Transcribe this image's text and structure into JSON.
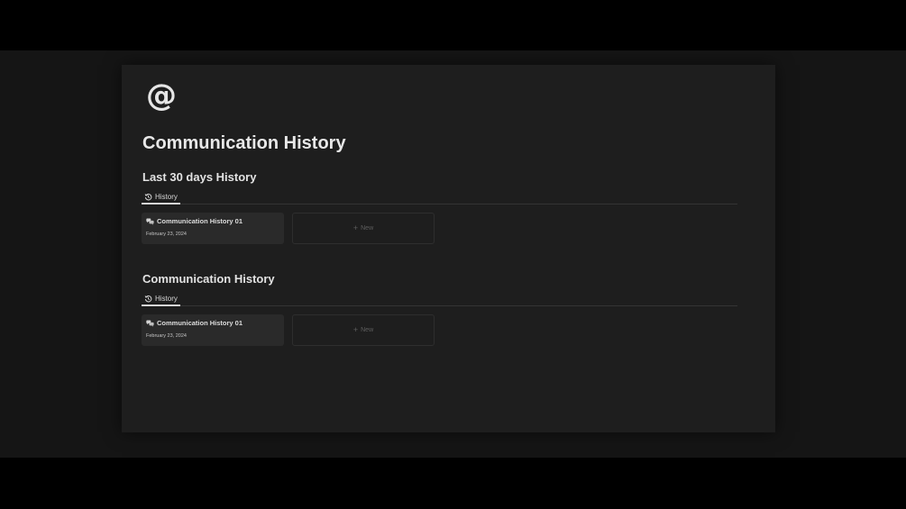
{
  "page": {
    "icon": "at-sign-icon",
    "title": "Communication History"
  },
  "sections": [
    {
      "title": "Last 30 days History",
      "tab": {
        "label": "History",
        "icon": "history-icon"
      },
      "cards": [
        {
          "title": "Communication History 01",
          "icon": "chat-icon",
          "date": "February 23, 2024"
        }
      ],
      "new_label": "New"
    },
    {
      "title": "Communication History",
      "tab": {
        "label": "History",
        "icon": "history-icon"
      },
      "cards": [
        {
          "title": "Communication History 01",
          "icon": "chat-icon",
          "date": "February 23, 2024"
        }
      ],
      "new_label": "New"
    }
  ],
  "colors": {
    "page_background": "#1e1e1e",
    "outer_background": "#151515",
    "card_background": "#2a2a2a",
    "text": "#e8e8e8",
    "muted_text": "#5e5e5e"
  }
}
